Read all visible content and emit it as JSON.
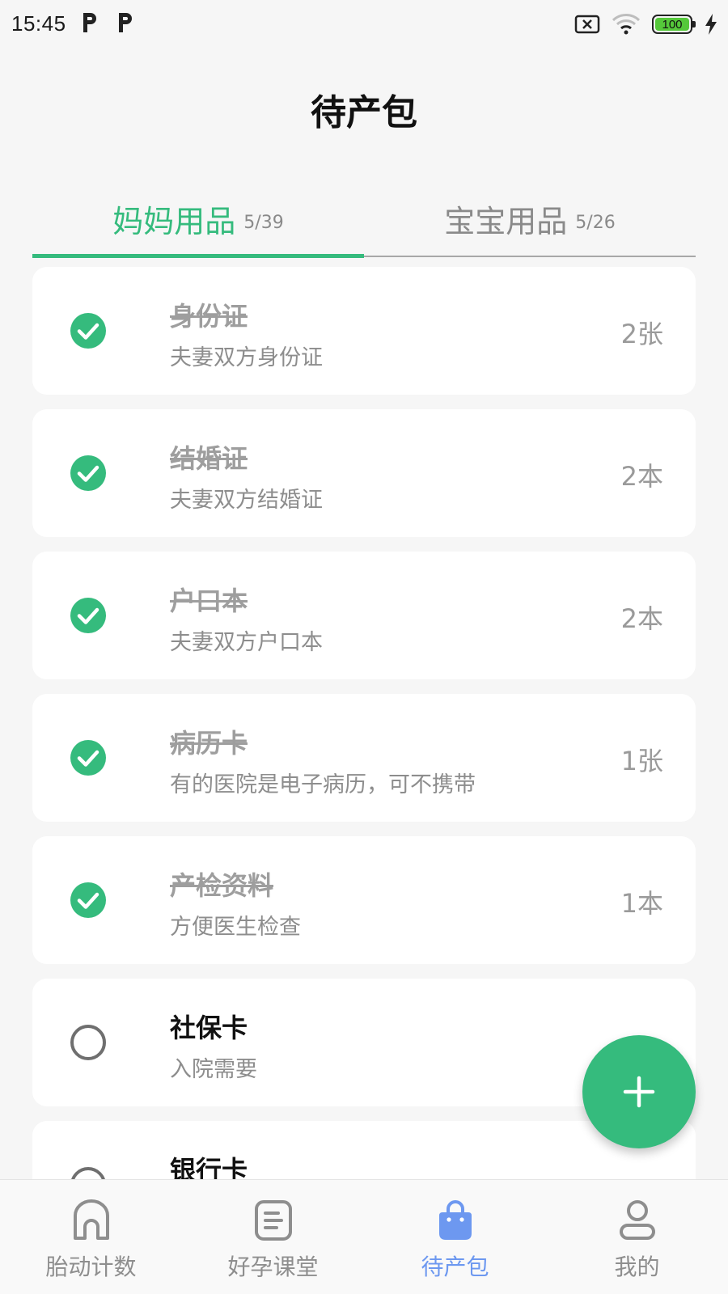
{
  "status_bar": {
    "time": "15:45",
    "battery": "100"
  },
  "header": {
    "title": "待产包"
  },
  "tabs": [
    {
      "label": "妈妈用品",
      "count": "5/39",
      "active": true
    },
    {
      "label": "宝宝用品",
      "count": "5/26",
      "active": false
    }
  ],
  "items": [
    {
      "name": "身份证",
      "note": "夫妻双方身份证",
      "qty": "2张",
      "checked": true
    },
    {
      "name": "结婚证",
      "note": "夫妻双方结婚证",
      "qty": "2本",
      "checked": true
    },
    {
      "name": "户口本",
      "note": "夫妻双方户口本",
      "qty": "2本",
      "checked": true
    },
    {
      "name": "病历卡",
      "note": "有的医院是电子病历，可不携带",
      "qty": "1张",
      "checked": true
    },
    {
      "name": "产检资料",
      "note": "方便医生检查",
      "qty": "1本",
      "checked": true
    },
    {
      "name": "社保卡",
      "note": "入院需要",
      "qty": "",
      "checked": false
    },
    {
      "name": "银行卡",
      "note": "",
      "qty": "",
      "checked": false
    }
  ],
  "bottom_nav": [
    {
      "label": "胎动计数",
      "icon": "home-icon",
      "active": false
    },
    {
      "label": "好孕课堂",
      "icon": "document-icon",
      "active": false
    },
    {
      "label": "待产包",
      "icon": "bag-icon",
      "active": true
    },
    {
      "label": "我的",
      "icon": "person-icon",
      "active": false
    }
  ],
  "colors": {
    "accent": "#35bb7d",
    "nav_active": "#6d98f0",
    "inactive": "#8e8e8e"
  }
}
